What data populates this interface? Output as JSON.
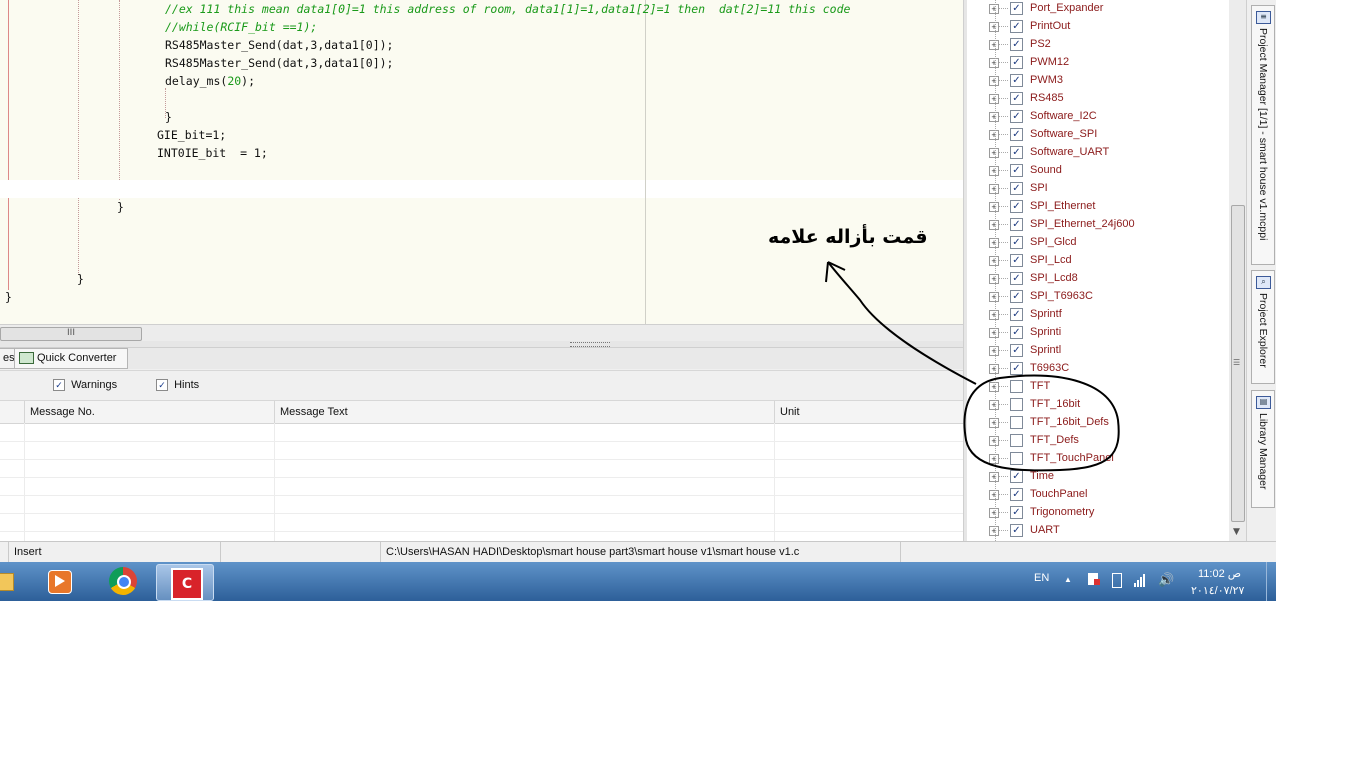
{
  "editor": {
    "lines": [
      {
        "kind": "comment",
        "text": "//ex 111 this mean data1[0]=1 this address of room, data1[1]=1,data1[2]=1 then  dat[2]=11 this code"
      },
      {
        "kind": "comment",
        "text": "//while(RCIF_bit ==1);"
      },
      {
        "kind": "code",
        "text": "RS485Master_Send(dat,3,data1[0]);"
      },
      {
        "kind": "code",
        "text": "RS485Master_Send(dat,3,data1[0]);"
      },
      {
        "kind": "code",
        "pre": "delay_ms(",
        "num": "20",
        "post": ");"
      },
      {
        "kind": "code",
        "text": "}"
      },
      {
        "kind": "code",
        "text": "GIE_bit=1;"
      },
      {
        "kind": "code",
        "text": "INT0IE_bit  = 1;"
      },
      {
        "kind": "code",
        "text": "}"
      },
      {
        "kind": "code",
        "text": "}"
      },
      {
        "kind": "code",
        "text": "}"
      }
    ],
    "hscroll_thumb": "III"
  },
  "messages": {
    "tabs": [
      {
        "label": "es"
      },
      {
        "label": "Quick Converter"
      }
    ],
    "filters": [
      {
        "label": "Warnings",
        "checked": "✓"
      },
      {
        "label": "Hints",
        "checked": "✓"
      }
    ],
    "columns": [
      "Message No.",
      "Message Text",
      "Unit"
    ]
  },
  "library_tree": {
    "items": [
      {
        "label": "Port_Expander",
        "checked": "✓"
      },
      {
        "label": "PrintOut",
        "checked": "✓"
      },
      {
        "label": "PS2",
        "checked": "✓"
      },
      {
        "label": "PWM12",
        "checked": "✓"
      },
      {
        "label": "PWM3",
        "checked": "✓"
      },
      {
        "label": "RS485",
        "checked": "✓"
      },
      {
        "label": "Software_I2C",
        "checked": "✓"
      },
      {
        "label": "Software_SPI",
        "checked": "✓"
      },
      {
        "label": "Software_UART",
        "checked": "✓"
      },
      {
        "label": "Sound",
        "checked": "✓"
      },
      {
        "label": "SPI",
        "checked": "✓"
      },
      {
        "label": "SPI_Ethernet",
        "checked": "✓"
      },
      {
        "label": "SPI_Ethernet_24j600",
        "checked": "✓"
      },
      {
        "label": "SPI_Glcd",
        "checked": "✓"
      },
      {
        "label": "SPI_Lcd",
        "checked": "✓"
      },
      {
        "label": "SPI_Lcd8",
        "checked": "✓"
      },
      {
        "label": "SPI_T6963C",
        "checked": "✓"
      },
      {
        "label": "Sprintf",
        "checked": "✓"
      },
      {
        "label": "Sprinti",
        "checked": "✓"
      },
      {
        "label": "Sprintl",
        "checked": "✓"
      },
      {
        "label": "T6963C",
        "checked": "✓"
      },
      {
        "label": "TFT",
        "checked": ""
      },
      {
        "label": "TFT_16bit",
        "checked": ""
      },
      {
        "label": "TFT_16bit_Defs",
        "checked": ""
      },
      {
        "label": "TFT_Defs",
        "checked": ""
      },
      {
        "label": "TFT_TouchPanel",
        "checked": ""
      },
      {
        "label": "Time",
        "checked": "✓"
      },
      {
        "label": "TouchPanel",
        "checked": "✓"
      },
      {
        "label": "Trigonometry",
        "checked": "✓"
      },
      {
        "label": "UART",
        "checked": "✓"
      }
    ],
    "expander_glyph": "+"
  },
  "side_tabs": [
    {
      "label": "Project Manager [1/1] - smart house v1.mcppi",
      "icon": "≡"
    },
    {
      "label": "Project Explorer",
      "icon": "⌕"
    },
    {
      "label": "Library Manager",
      "icon": "▤"
    }
  ],
  "statusbar": {
    "mode": "Insert",
    "path": "C:\\Users\\HASAN HADI\\Desktop\\smart house part3\\smart house v1\\smart house v1.c"
  },
  "taskbar": {
    "language": "EN",
    "time": "11:02 ص",
    "date": "٢٠١٤/٠٧/٢٧",
    "tray_up": "▲"
  },
  "annotation": {
    "text": "قمت بأزاله علامه"
  },
  "colors": {
    "comment": "#1a9a1a",
    "tree_label": "#8b1a1a",
    "taskbar": "#2d5f99"
  }
}
